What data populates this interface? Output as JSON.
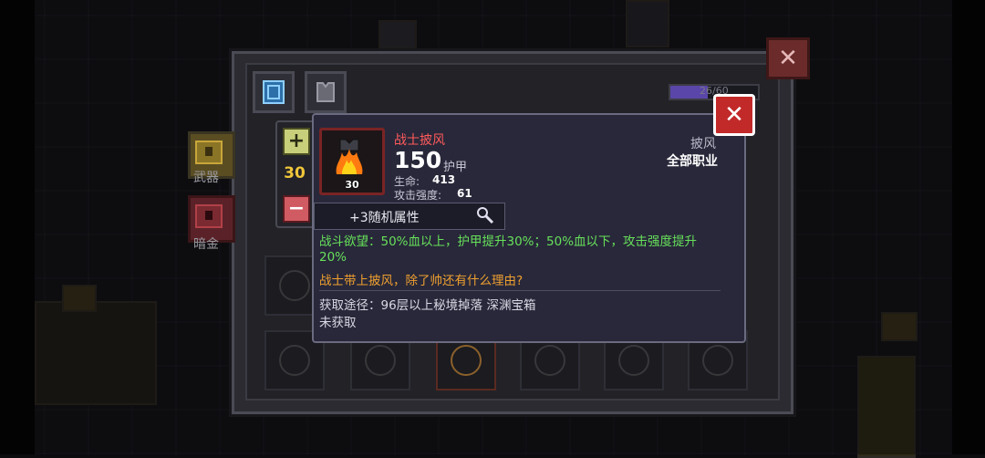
{
  "panel": {
    "close_glyph": "✕",
    "capacity_text": "26/60",
    "capacity_fill": 0.43
  },
  "side_items": [
    {
      "label": "武器",
      "icon": "weapon-chest-icon"
    },
    {
      "label": "暗金",
      "icon": "dark-gold-chest-icon"
    }
  ],
  "quantity": {
    "plus_glyph": "+",
    "value": "30",
    "minus_glyph": "−"
  },
  "item": {
    "name": "战士披风",
    "icon": "flame-cloak-icon",
    "level_badge": "30",
    "armor_value": "150",
    "armor_label": "护甲",
    "stats": [
      {
        "label": "生命:",
        "value": "413"
      },
      {
        "label": "攻击强度:",
        "value": "61"
      }
    ],
    "type": "披风",
    "class": "全部职业",
    "random_attr": "+3随机属性",
    "effect": "战斗欲望：50%血以上，护甲提升30%；50%血以下，攻击强度提升20%",
    "flavor": "战士带上披风，除了帅还有什么理由?",
    "source": "获取途径：96层以上秘境掉落 深渊宝箱",
    "status": "未获取"
  },
  "tooltip": {
    "close_glyph": "✕"
  },
  "colors": {
    "item_name": "#ff5a5a",
    "effect_text": "#67e05a",
    "flavor_text": "#f0a030",
    "quantity_value": "#f0c63a",
    "close_red": "#c22a2a"
  }
}
